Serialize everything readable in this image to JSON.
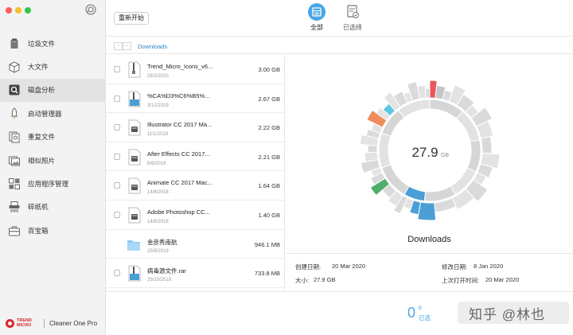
{
  "sidebar": {
    "items": [
      {
        "label": "垃圾文件",
        "icon": "trash-icon"
      },
      {
        "label": "大文件",
        "icon": "box-icon"
      },
      {
        "label": "磁盘分析",
        "icon": "disk-analysis-icon",
        "active": true
      },
      {
        "label": "启动管理器",
        "icon": "rocket-icon"
      },
      {
        "label": "重复文件",
        "icon": "duplicate-icon"
      },
      {
        "label": "相似照片",
        "icon": "photos-icon"
      },
      {
        "label": "应用程序管理",
        "icon": "apps-icon"
      },
      {
        "label": "碎纸机",
        "icon": "shredder-icon"
      },
      {
        "label": "百宝箱",
        "icon": "toolbox-icon"
      }
    ],
    "brand": {
      "logo_text": "TREND MICRO",
      "product": "Cleaner One Pro"
    }
  },
  "toolbar": {
    "restart_label": "重新开始",
    "tabs": [
      {
        "label": "全部",
        "active": true
      },
      {
        "label": "已选择",
        "active": false
      }
    ]
  },
  "breadcrumb": {
    "current": "Downloads"
  },
  "files": [
    {
      "name": "Trend_Micro_Icons_v6...",
      "date": "26/2/2020",
      "size": "3.00 GB",
      "icon": "zip-file-icon"
    },
    {
      "name": "%CA%D3%C6%B5%...",
      "date": "3/12/2019",
      "size": "2.67 GB",
      "icon": "archive-file-icon"
    },
    {
      "name": "Illustrator CC 2017 Ma...",
      "date": "11/1/2019",
      "size": "2.22 GB",
      "icon": "dmg-file-icon"
    },
    {
      "name": "After Effects CC 2017...",
      "date": "6/8/2019",
      "size": "2.21 GB",
      "icon": "dmg-file-icon"
    },
    {
      "name": "Animate CC 2017 Mac...",
      "date": "14/8/2018",
      "size": "1.64 GB",
      "icon": "dmg-file-icon"
    },
    {
      "name": "Adobe Photoshop CC...",
      "date": "14/8/2018",
      "size": "1.40 GB",
      "icon": "dmg-file-icon"
    },
    {
      "name": "金彦秀南航",
      "date": "25/9/2019",
      "size": "946.1 MB",
      "icon": "folder-icon"
    },
    {
      "name": "病毒源文件.rar",
      "date": "29/10/2019",
      "size": "733.8 MB",
      "icon": "archive-file-icon"
    }
  ],
  "panel": {
    "total_value": "27.9",
    "total_unit": "GB",
    "title": "Downloads",
    "created_label": "创建日期:",
    "created_value": "20 Mar 2020",
    "modified_label": "修改日期:",
    "modified_value": "8 Jan 2020",
    "size_label": "大小:",
    "size_value": "27.9 GB",
    "opened_label": "上次打开时间:",
    "opened_value": "20 Mar 2020"
  },
  "chart_data": {
    "type": "pie",
    "variant": "sunburst-donut",
    "total_label": "27.9 GB",
    "colors": {
      "accent_red": "#e8555a",
      "accent_blue": "#4a9fd6",
      "accent_orange": "#ee8c5e",
      "accent_green": "#4eae6b",
      "accent_cyan": "#5fc8e0",
      "neutral": "#dcdcdc"
    }
  },
  "footer": {
    "count": "0",
    "count_unit": "B",
    "selected_label": "已选",
    "watermark": "知乎 @林也"
  },
  "colors": {
    "accent": "#2e86c9",
    "selected_blue": "#4aa6e6",
    "sidebar_bg": "#f3f3f3"
  }
}
